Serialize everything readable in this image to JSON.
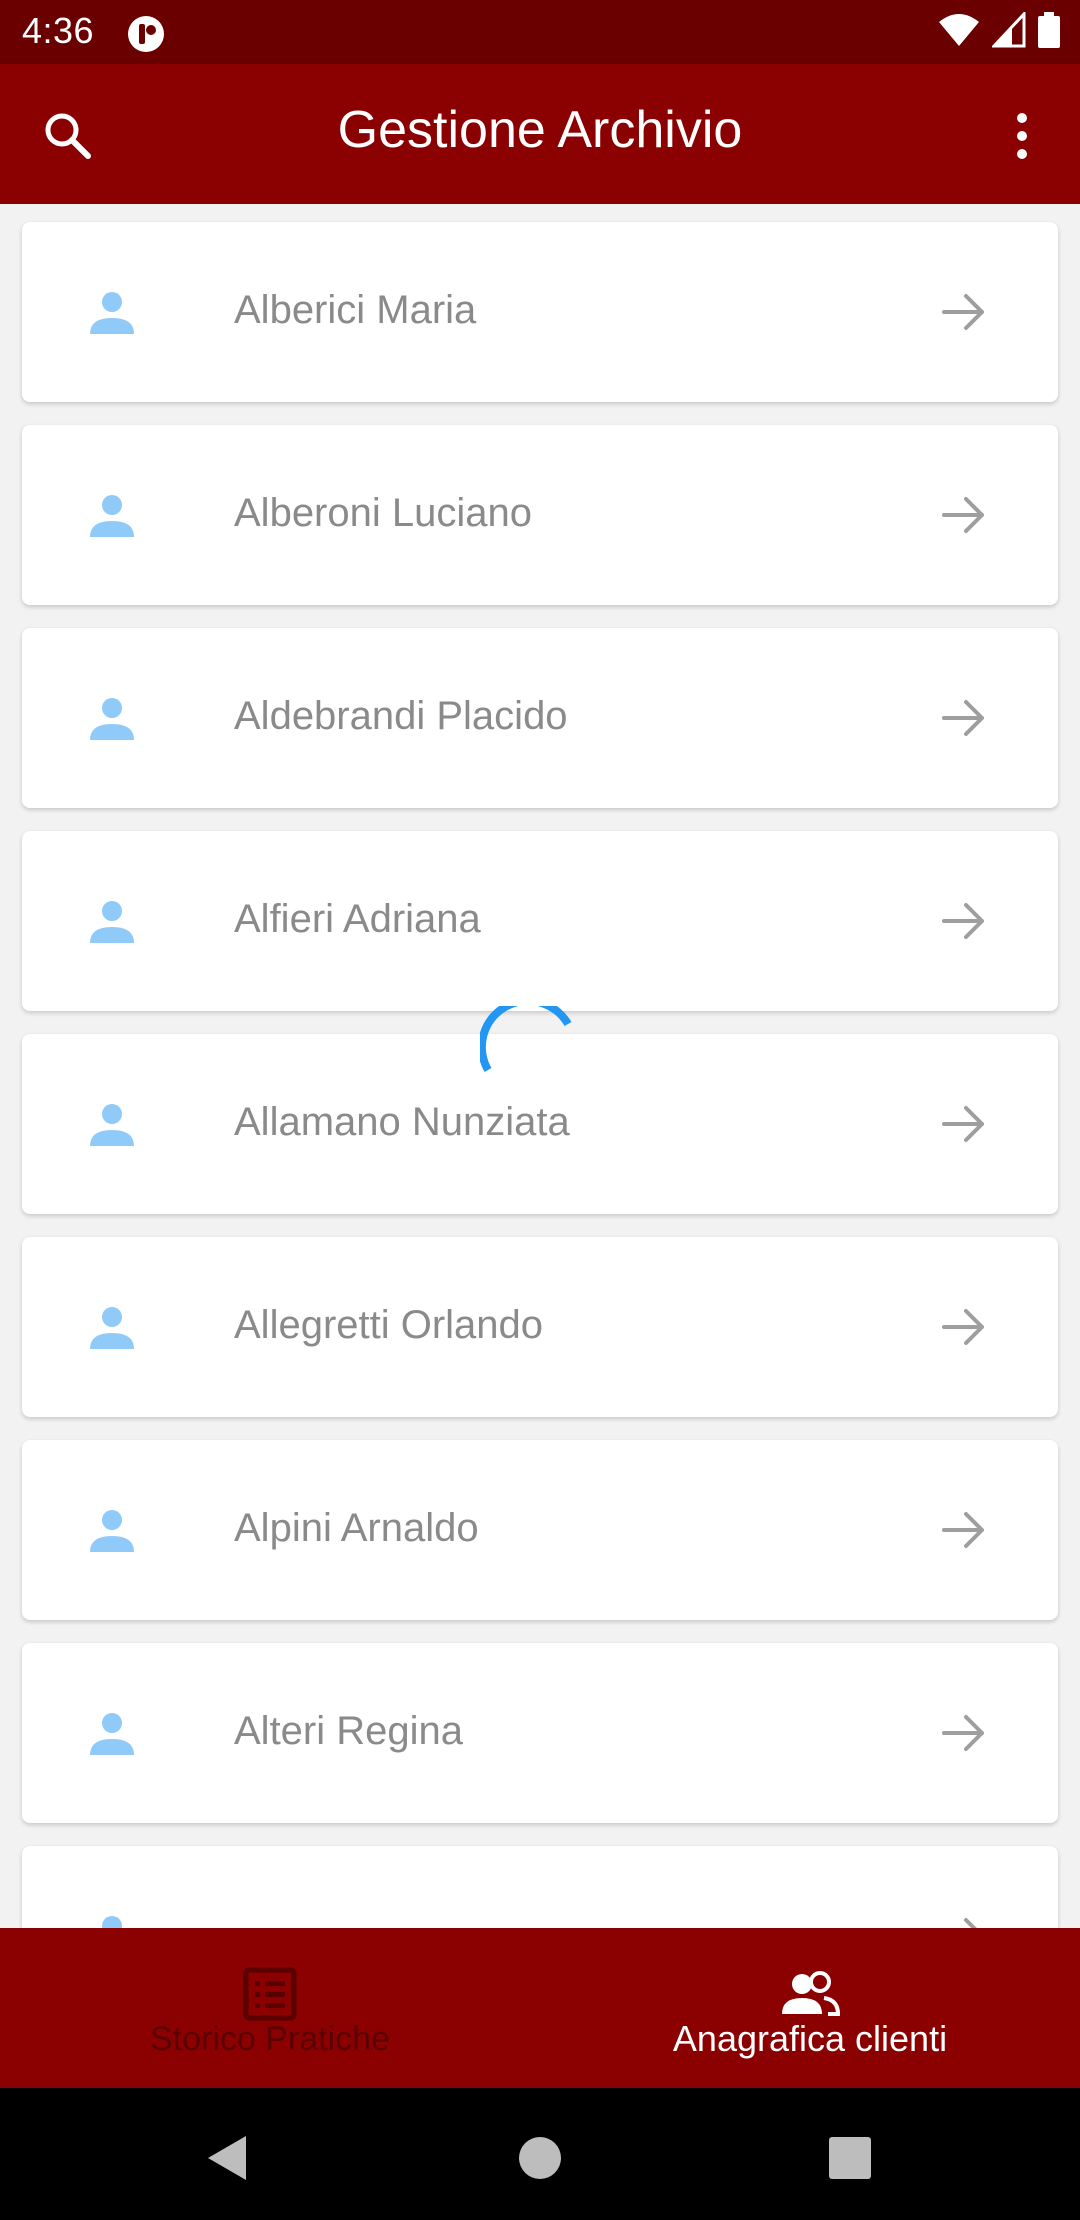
{
  "status_bar": {
    "time": "4:36",
    "icons": [
      "app-notification-icon",
      "wifi-icon",
      "signal-icon",
      "battery-icon"
    ]
  },
  "app_bar": {
    "title": "Gestione Archivio",
    "icons": [
      "search-icon",
      "more-vert-icon"
    ],
    "background": "#8b0000"
  },
  "clients": [
    {
      "name": "Alberici Maria"
    },
    {
      "name": "Alberoni Luciano"
    },
    {
      "name": "Aldebrandi Placido"
    },
    {
      "name": "Alfieri Adriana"
    },
    {
      "name": "Allamano Nunziata"
    },
    {
      "name": "Allegretti Orlando"
    },
    {
      "name": "Alpini Arnaldo"
    },
    {
      "name": "Alteri Regina"
    }
  ],
  "bottom_nav": {
    "items": [
      {
        "label": "Storico Pratiche",
        "icon": "list-icon",
        "active": false
      },
      {
        "label": "Anagrafica clienti",
        "icon": "people-icon",
        "active": true
      }
    ]
  },
  "colors": {
    "primary": "#8b0000",
    "status_bar": "#6a0000",
    "person_icon": "#90caf9",
    "spinner": "#2196f3"
  }
}
